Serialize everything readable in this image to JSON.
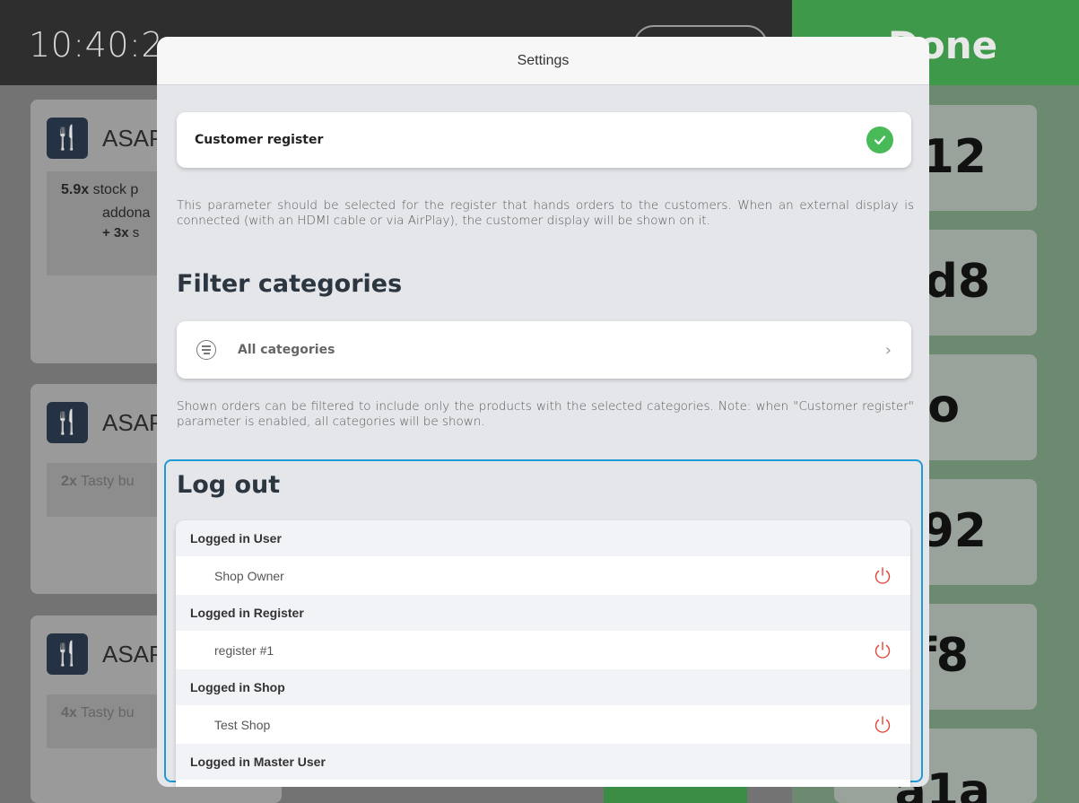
{
  "background": {
    "clock": "10:40:2",
    "done_label": "Done",
    "orders": [
      {
        "badge": "ASAP",
        "lines": [
          {
            "qty": "5.9x",
            "text": "stock p"
          },
          {
            "qty": "",
            "text": "addona"
          },
          {
            "qty": "+ 3x",
            "text": "s"
          }
        ]
      },
      {
        "badge": "ASAP",
        "lines": [
          {
            "qty": "2x",
            "text": "Tasty bu"
          }
        ]
      },
      {
        "badge": "ASAP",
        "lines": [
          {
            "qty": "4x",
            "text": "Tasty bu"
          }
        ]
      }
    ],
    "tickets": [
      "12",
      "d8",
      "fo",
      "92",
      "f8",
      "a1a"
    ]
  },
  "modal": {
    "title": "Settings",
    "customer_register": {
      "label": "Customer register",
      "checked": true,
      "help": "This parameter should be selected for the register that hands orders to the customers. When an external display is connected (with an HDMI cable or via AirPlay), the customer display will be shown on it."
    },
    "filter": {
      "title": "Filter categories",
      "value": "All categories",
      "help": "Shown orders can be filtered to include only the products with the selected categories. Note: when \"Customer register\" parameter is enabled, all categories will be shown."
    },
    "logout": {
      "title": "Log out",
      "groups": [
        {
          "header": "Logged in User",
          "item": "Shop Owner"
        },
        {
          "header": "Logged in Register",
          "item": "register #1"
        },
        {
          "header": "Logged in Shop",
          "item": "Test Shop"
        },
        {
          "header": "Logged in Master User",
          "item": ""
        }
      ]
    }
  },
  "colors": {
    "accent_blue": "#1e9ad6",
    "check_green": "#48bb58",
    "power_red": "#e0463a"
  }
}
